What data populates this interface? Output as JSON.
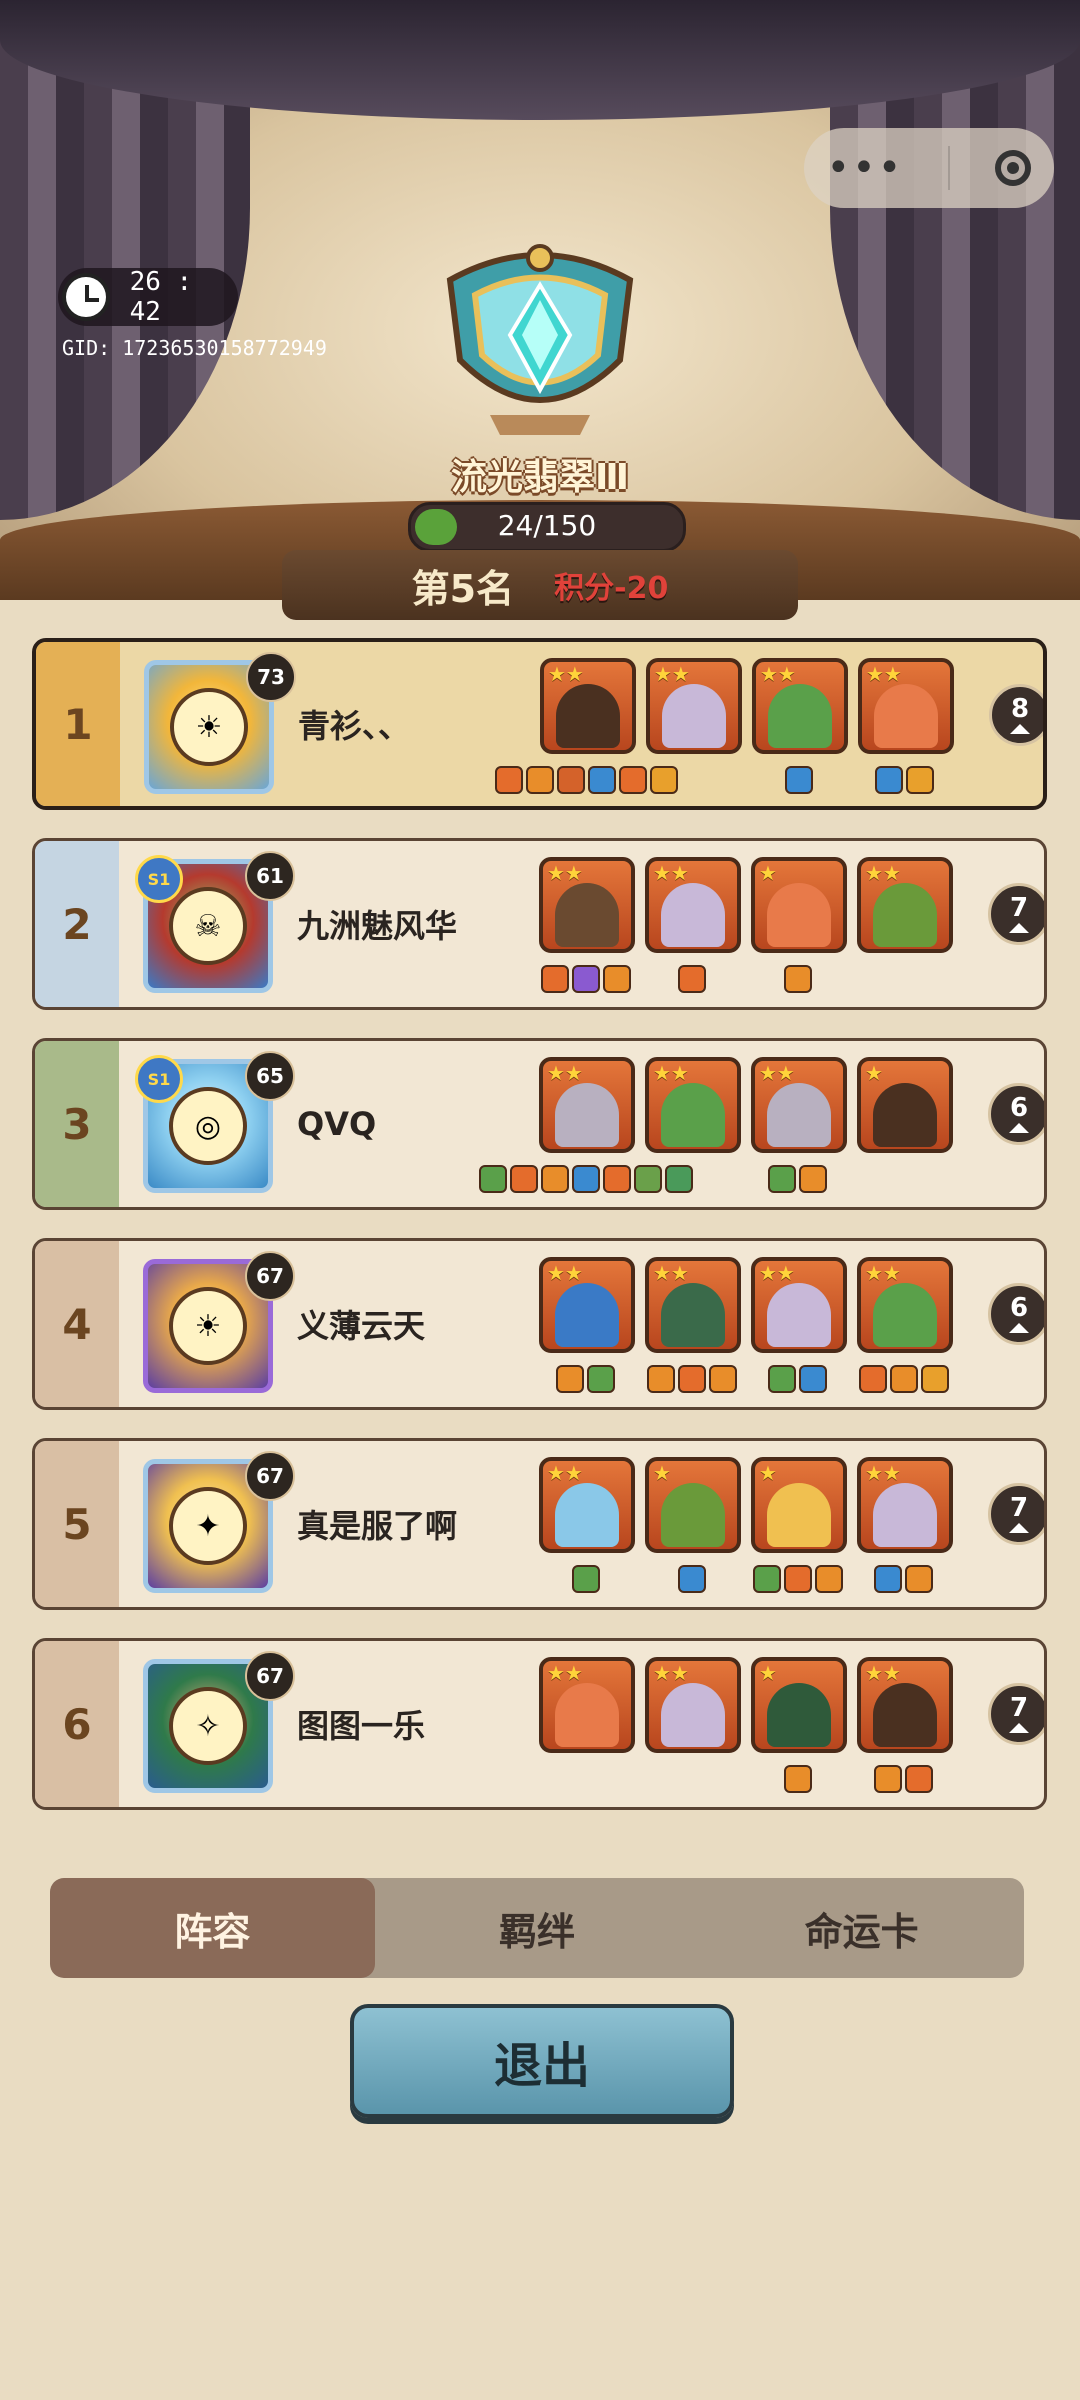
{
  "timer": {
    "time": "26 : 42"
  },
  "gid": "GID: 17236530158772949",
  "rank": {
    "name": "流光翡翠Ⅲ",
    "progress_text": "24/150",
    "progress_fraction": 0.16
  },
  "result": {
    "place": "第5名",
    "score": "积分-20"
  },
  "players": [
    {
      "rank": "1",
      "name": "青衫、、",
      "level": "73",
      "season": "",
      "round": "8",
      "self": true,
      "strip_color": "#e4b055",
      "avatar_style": "",
      "face": "☀",
      "units": [
        {
          "stars": "★★",
          "color": "#4a3020",
          "items": [
            "#e46c2c",
            "#e88d2a",
            "#d4622a",
            "#3a8ad0",
            "#e46c2c",
            "#e8a02c"
          ]
        },
        {
          "stars": "★★",
          "color": "#c8b8d8",
          "items": []
        },
        {
          "stars": "★★",
          "color": "#5aa04a",
          "items": [
            "#3a8ad0"
          ]
        },
        {
          "stars": "★★",
          "color": "#e87a4a",
          "items": [
            "#3a8ad0",
            "#e8a02c"
          ]
        }
      ]
    },
    {
      "rank": "2",
      "name": "九洲魅风华",
      "level": "61",
      "season": "S1",
      "round": "7",
      "self": false,
      "strip_color": "#c5d5e2",
      "avatar_style": "red",
      "face": "☠",
      "units": [
        {
          "stars": "★★",
          "color": "#6a4a30",
          "items": [
            "#e46c2c",
            "#8a5ad0",
            "#e88d2a"
          ]
        },
        {
          "stars": "★★",
          "color": "#c8b8d8",
          "items": [
            "#e46c2c"
          ]
        },
        {
          "stars": "★",
          "color": "#e87a4a",
          "items": [
            "#e88d2a"
          ]
        },
        {
          "stars": "★★",
          "color": "#6a9a3a",
          "items": []
        }
      ]
    },
    {
      "rank": "3",
      "name": "QVQ",
      "level": "65",
      "season": "S1",
      "round": "6",
      "self": false,
      "strip_color": "#a9ba8a",
      "avatar_style": "teal",
      "face": "◎",
      "units": [
        {
          "stars": "★★",
          "color": "#b8b0c0",
          "items": [
            "#5aa04a",
            "#e46c2c",
            "#e88d2a",
            "#3a8ad0",
            "#e46c2c",
            "#6aa04a",
            "#4a9a5a"
          ]
        },
        {
          "stars": "★★",
          "color": "#5aa04a",
          "items": []
        },
        {
          "stars": "★★",
          "color": "#b8b0c0",
          "items": [
            "#5aa04a",
            "#e88d2a"
          ]
        },
        {
          "stars": "★",
          "color": "#4a3020",
          "items": []
        }
      ]
    },
    {
      "rank": "4",
      "name": "义薄云天",
      "level": "67",
      "season": "",
      "round": "6",
      "self": false,
      "strip_color": "#d9bfa4",
      "avatar_style": "purple",
      "face": "☀",
      "units": [
        {
          "stars": "★★",
          "color": "#3a7ac6",
          "items": [
            "#e88d2a",
            "#5aa04a"
          ]
        },
        {
          "stars": "★★",
          "color": "#3a6a4a",
          "items": [
            "#e88d2a",
            "#e46c2c",
            "#e88d2a"
          ]
        },
        {
          "stars": "★★",
          "color": "#c8b8d8",
          "items": [
            "#5aa04a",
            "#3a8ad0"
          ]
        },
        {
          "stars": "★★",
          "color": "#5aa04a",
          "items": [
            "#e46c2c",
            "#e88d2a",
            "#e8a02c"
          ]
        }
      ]
    },
    {
      "rank": "5",
      "name": "真是服了啊",
      "level": "67",
      "season": "",
      "round": "7",
      "self": false,
      "strip_color": "#d9bfa4",
      "avatar_style": "blonde",
      "face": "✦",
      "units": [
        {
          "stars": "★★",
          "color": "#8ac8e8",
          "items": [
            "#5aa04a"
          ]
        },
        {
          "stars": "★",
          "color": "#6a9a3a",
          "items": [
            "#3a8ad0"
          ]
        },
        {
          "stars": "★",
          "color": "#f0c050",
          "items": [
            "#5aa04a",
            "#e46c2c",
            "#e88d2a"
          ]
        },
        {
          "stars": "★★",
          "color": "#c8b8d8",
          "items": [
            "#3a8ad0",
            "#e88d2a"
          ]
        }
      ]
    },
    {
      "rank": "6",
      "name": "图图一乐",
      "level": "67",
      "season": "",
      "round": "7",
      "self": false,
      "strip_color": "#d9bfa4",
      "avatar_style": "green",
      "face": "✧",
      "units": [
        {
          "stars": "★★",
          "color": "#e87a4a",
          "items": []
        },
        {
          "stars": "★★",
          "color": "#c8b8d8",
          "items": []
        },
        {
          "stars": "★",
          "color": "#2f5a3a",
          "items": [
            "#e88d2a"
          ]
        },
        {
          "stars": "★★",
          "color": "#4a3020",
          "items": [
            "#e88d2a",
            "#e46c2c"
          ]
        }
      ]
    }
  ],
  "tabs": [
    {
      "label": "阵容",
      "active": true
    },
    {
      "label": "羁绊",
      "active": false
    },
    {
      "label": "命运卡",
      "active": false
    }
  ],
  "exit_label": "退出"
}
